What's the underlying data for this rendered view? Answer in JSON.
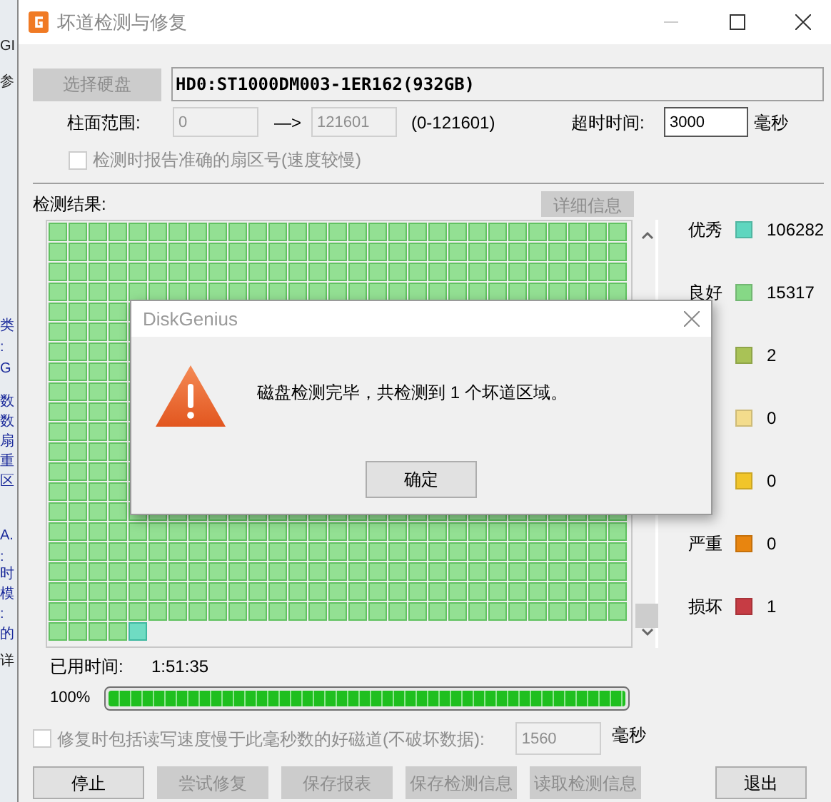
{
  "background_window": {
    "texts": [
      {
        "text": "GI",
        "kind": "plain"
      },
      {
        "text": "参",
        "kind": "plain"
      },
      {
        "text": "类",
        "kind": "link"
      },
      {
        "text": ":",
        "kind": "link"
      },
      {
        "text": "G",
        "kind": "link"
      },
      {
        "text": "数",
        "kind": "link"
      },
      {
        "text": "数",
        "kind": "link"
      },
      {
        "text": "扇",
        "kind": "link"
      },
      {
        "text": "重",
        "kind": "link"
      },
      {
        "text": "区",
        "kind": "link"
      },
      {
        "text": "A.",
        "kind": "link"
      },
      {
        "text": ":",
        "kind": "link"
      },
      {
        "text": "时",
        "kind": "link"
      },
      {
        "text": "模",
        "kind": "link"
      },
      {
        "text": ":",
        "kind": "link"
      },
      {
        "text": "的",
        "kind": "link"
      },
      {
        "text": "详",
        "kind": "plain"
      }
    ]
  },
  "window": {
    "title": "坏道检测与修复"
  },
  "disk": {
    "select_button": {
      "label": "选择硬盘",
      "disabled": true
    },
    "value": "HD0:ST1000DM003-1ER162(932GB)"
  },
  "cylinder_range": {
    "label": "柱面范围:",
    "from": {
      "value": "0",
      "disabled": true
    },
    "arrow": "—>",
    "to": {
      "value": "121601",
      "disabled": true
    },
    "hint": "(0-121601)"
  },
  "timeout": {
    "label": "超时时间:",
    "value": "3000",
    "unit": "毫秒"
  },
  "report_exact_sector": {
    "label": "检测时报告准确的扇区号(速度较慢)",
    "checked": false,
    "disabled": true
  },
  "results": {
    "label": "检测结果:",
    "details_button": {
      "label": "详细信息",
      "disabled": true
    }
  },
  "legend": [
    {
      "label": "优秀",
      "color": "#5fd6bf",
      "count": "106282"
    },
    {
      "label": "良好",
      "color": "#86d886",
      "count": "15317"
    },
    {
      "color": "#a9c256",
      "count": "2"
    },
    {
      "color": "#f3dc8c",
      "count": "0"
    },
    {
      "color": "#f1c52a",
      "count": "0"
    },
    {
      "label": "严重",
      "color": "#e8850f",
      "count": "0"
    },
    {
      "label": "损坏",
      "color": "#c63c44",
      "count": "1"
    }
  ],
  "elapsed": {
    "label": "已用时间:",
    "value": "1:51:35"
  },
  "progress": {
    "reading": "100%",
    "level": 1
  },
  "slow_tracks": {
    "label": "修复时包括读写速度慢于此毫秒数的好磁道(不破坏数据):",
    "checked": false,
    "disabled": true,
    "value": "1560",
    "value_disabled": true,
    "unit": "毫秒"
  },
  "buttons": [
    {
      "label": "停止",
      "disabled": false
    },
    {
      "label": "尝试修复",
      "disabled": true
    },
    {
      "label": "保存报表",
      "disabled": true
    },
    {
      "label": "保存检测信息",
      "disabled": true
    },
    {
      "label": "读取检测信息",
      "disabled": true
    },
    {
      "label": "退出",
      "disabled": false
    }
  ],
  "dialog": {
    "title": "DiskGenius",
    "message": "磁盘检测完毕，共检测到 1 个坏道区域。",
    "button": "确定"
  }
}
